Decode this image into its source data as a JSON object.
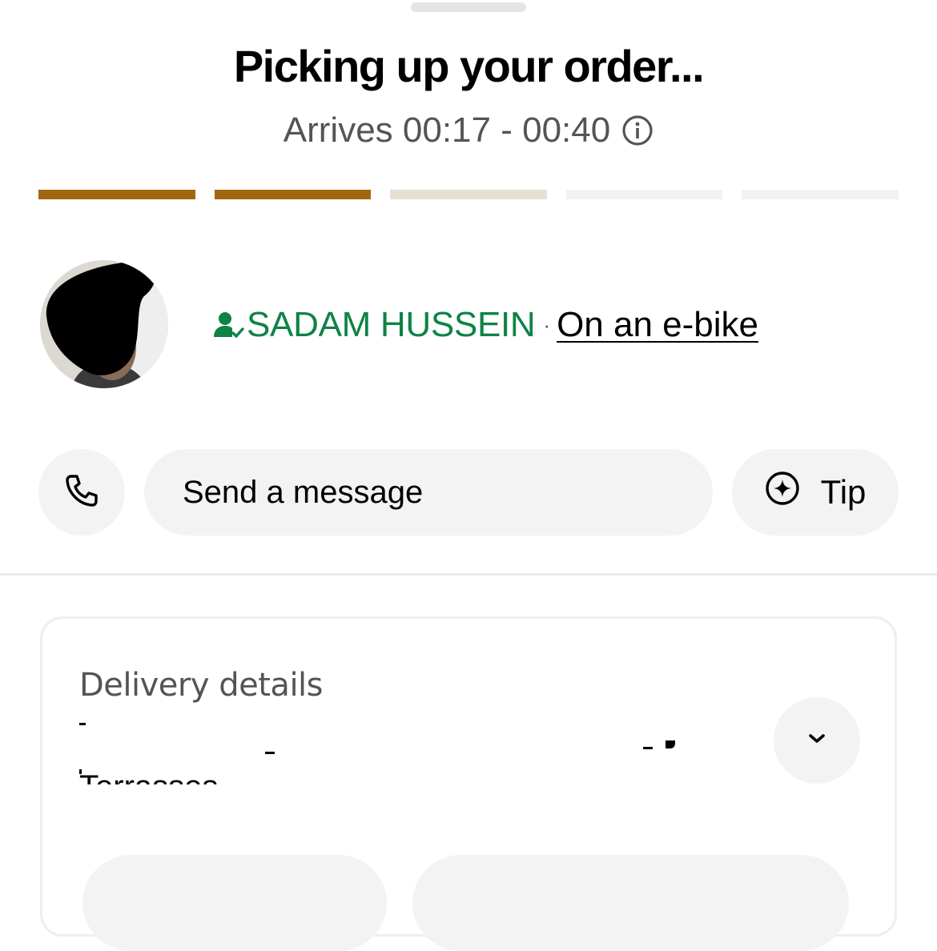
{
  "status": {
    "title": "Picking up your order...",
    "arrival": "Arrives 00:17 - 00:40"
  },
  "progress": {
    "total_steps": 5,
    "completed_steps": 2,
    "active_step": 3,
    "colors": {
      "completed": "#a0670e",
      "active": "#e6e0d4",
      "pending": "#f2f2f2"
    }
  },
  "courier": {
    "name": "SADAM HUSSEIN",
    "separator": "·",
    "vehicle": "On an e-bike",
    "name_color": "#0e8345"
  },
  "actions": {
    "message_label": "Send a message",
    "tip_label": "Tip"
  },
  "delivery": {
    "label": "Delivery details",
    "address_partial": "Terrasses"
  },
  "icons": [
    "info-icon",
    "verified-courier-icon",
    "phone-icon",
    "tip-icon",
    "chevron-down-icon"
  ]
}
